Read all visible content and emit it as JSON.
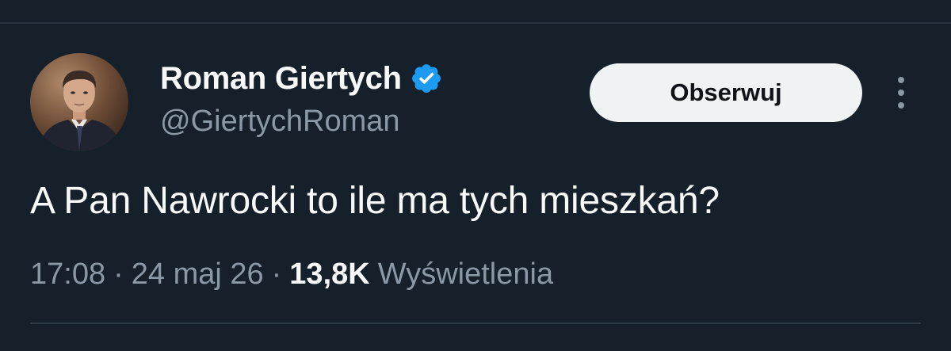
{
  "tweet": {
    "author": {
      "display_name": "Roman Giertych",
      "handle": "@GiertychRoman",
      "verified": true,
      "verified_icon": "verified-badge-icon",
      "verified_color": "#1d9bf0"
    },
    "follow_button_label": "Obserwuj",
    "more_icon": "more-vertical-icon",
    "text": "A Pan Nawrocki to ile ma tych mieszkań?",
    "meta": {
      "time": "17:08",
      "separator": "·",
      "date": "24 maj 26",
      "views_count": "13,8K",
      "views_label": "Wyświetlenia"
    }
  },
  "theme": {
    "background": "#15202b",
    "primary_text": "#f7f9f9",
    "secondary_text": "#8b98a5",
    "button_bg": "#eff3f4",
    "button_text": "#0f1419"
  }
}
